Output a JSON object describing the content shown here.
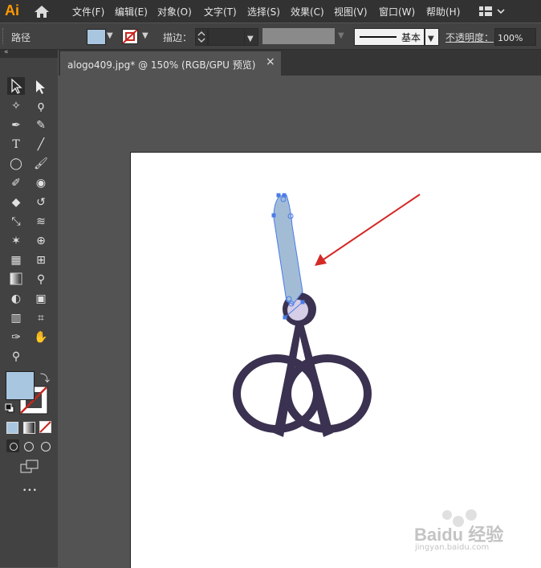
{
  "app": {
    "logo": "Ai"
  },
  "menu": [
    "文件(F)",
    "编辑(E)",
    "对象(O)",
    "文字(T)",
    "选择(S)",
    "效果(C)",
    "视图(V)",
    "窗口(W)",
    "帮助(H)"
  ],
  "control_bar": {
    "selection_type": "路径",
    "stroke_label": "描边：",
    "brush_label": "基本",
    "opacity_label": "不透明度：",
    "opacity_value": "100%"
  },
  "document_tab": {
    "title": "alogo409.jpg* @ 150% (RGB/GPU 预览)",
    "close": "×"
  },
  "tools": {
    "more": "•••"
  },
  "colors": {
    "fill": "#a9c6e0",
    "artwork_dark": "#3b3150",
    "shape_fill": "#a3bcd6",
    "arrow": "#d42a26",
    "accent_orange": "#ff9a00"
  },
  "watermark": {
    "brand": "Baidu 经验",
    "url": "jingyan.baidu.com"
  }
}
